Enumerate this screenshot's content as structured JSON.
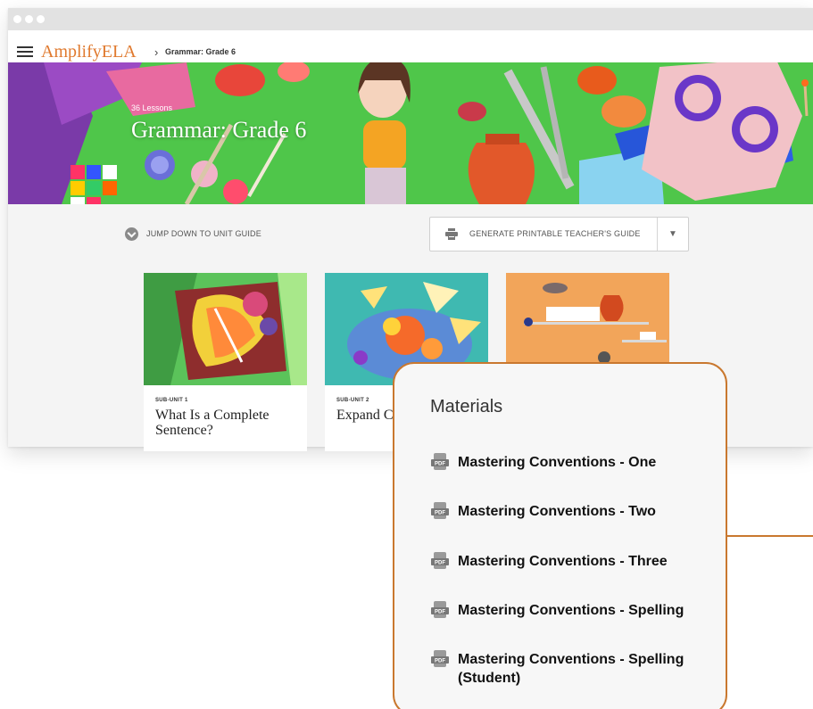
{
  "browser": {
    "controls": [
      "close-dot",
      "minimize-dot",
      "maximize-dot"
    ]
  },
  "navbar": {
    "brand_prefix": "Amplify",
    "brand_suffix": "ELA",
    "breadcrumb_separator": "›",
    "breadcrumb_current": "Grammar: Grade 6"
  },
  "hero": {
    "lessons_count": "36 Lessons",
    "title": "Grammar: Grade 6"
  },
  "toolbar": {
    "jump_label": "JUMP DOWN TO UNIT GUIDE",
    "generate_label": "GENERATE PRINTABLE TEACHER'S GUIDE",
    "dropdown_caret": "▼"
  },
  "cards": [
    {
      "sub_label": "SUB-UNIT 1",
      "title": "What Is a Complete Sentence?"
    },
    {
      "sub_label": "SUB-UNIT 2",
      "title": "Expand Comple"
    },
    {
      "sub_label": "",
      "title": ""
    }
  ],
  "materials": {
    "title": "Materials",
    "items": [
      {
        "label": "Mastering Conventions - One",
        "icon": "pdf-icon"
      },
      {
        "label": "Mastering Conventions - Two",
        "icon": "pdf-icon"
      },
      {
        "label": "Mastering Conventions - Three",
        "icon": "pdf-icon"
      },
      {
        "label": "Mastering Conventions - Spelling",
        "icon": "pdf-icon"
      },
      {
        "label": "Mastering Conventions - Spelling (Student)",
        "icon": "pdf-icon"
      }
    ]
  },
  "colors": {
    "brand_orange": "#e07a2f",
    "popup_border": "#c9782f",
    "hero_green": "#4fc64a"
  }
}
